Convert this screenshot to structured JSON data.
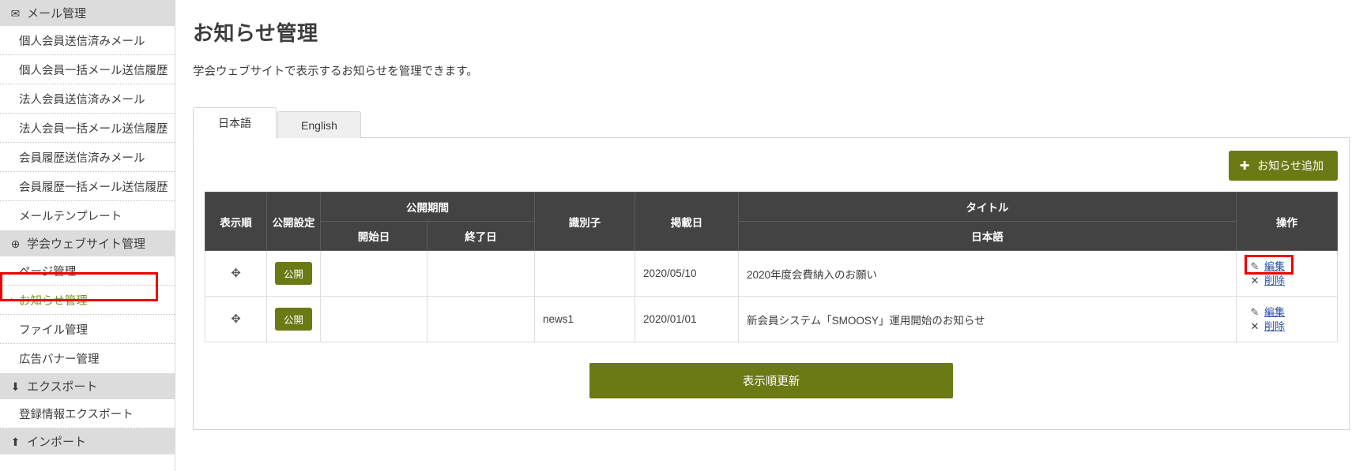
{
  "sidebar": {
    "groups": [
      {
        "icon": "envelope-icon",
        "glyph": "✉",
        "label": "メール管理",
        "items": [
          {
            "label": "個人会員送信済みメール",
            "active": false
          },
          {
            "label": "個人会員一括メール送信履歴",
            "active": false
          },
          {
            "label": "法人会員送信済みメール",
            "active": false
          },
          {
            "label": "法人会員一括メール送信履歴",
            "active": false
          },
          {
            "label": "会員履歴送信済みメール",
            "active": false
          },
          {
            "label": "会員履歴一括メール送信履歴",
            "active": false
          },
          {
            "label": "メールテンプレート",
            "active": false
          }
        ]
      },
      {
        "icon": "globe-icon",
        "glyph": "⊕",
        "label": "学会ウェブサイト管理",
        "items": [
          {
            "label": "ページ管理",
            "active": false
          },
          {
            "label": "お知らせ管理",
            "active": true
          },
          {
            "label": "ファイル管理",
            "active": false
          },
          {
            "label": "広告バナー管理",
            "active": false
          }
        ]
      },
      {
        "icon": "download-icon",
        "glyph": "⬇",
        "label": "エクスポート",
        "items": [
          {
            "label": "登録情報エクスポート",
            "active": false
          }
        ]
      },
      {
        "icon": "upload-icon",
        "glyph": "⬆",
        "label": "インポート",
        "items": []
      }
    ]
  },
  "main": {
    "title": "お知らせ管理",
    "description": "学会ウェブサイトで表示するお知らせを管理できます。",
    "tabs": [
      {
        "label": "日本語",
        "active": true
      },
      {
        "label": "English",
        "active": false
      }
    ],
    "add_button": {
      "label": "お知らせ追加",
      "plus": "✚"
    },
    "table": {
      "headers": {
        "order": "表示順",
        "publish_setting": "公開設定",
        "period": "公開期間",
        "period_start": "開始日",
        "period_end": "終了日",
        "identifier": "識別子",
        "post_date": "掲載日",
        "title": "タイトル",
        "title_lang": "日本語",
        "operation": "操作"
      },
      "rows": [
        {
          "drag": "✥",
          "publish": "公開",
          "start": "",
          "end": "",
          "identifier": "",
          "post_date": "2020/05/10",
          "title": "2020年度会費納入のお願い",
          "edit": "編集",
          "delete": "削除",
          "edit_highlighted": true
        },
        {
          "drag": "✥",
          "publish": "公開",
          "start": "",
          "end": "",
          "identifier": "news1",
          "post_date": "2020/01/01",
          "title": "新会員システム「SMOOSY」運用開始のお知らせ",
          "edit": "編集",
          "delete": "削除",
          "edit_highlighted": false
        }
      ]
    },
    "update_button": {
      "label": "表示順更新"
    }
  },
  "colors": {
    "accent_green": "#6b7a14",
    "header_dark": "#434343",
    "highlight_red": "#ee0000",
    "link_blue": "#2a4fa2"
  }
}
